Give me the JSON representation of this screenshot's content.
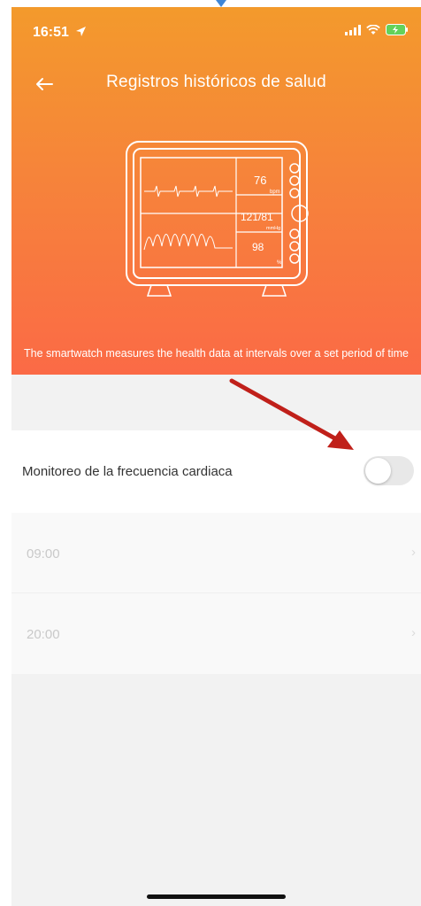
{
  "status": {
    "time": "16:51"
  },
  "nav": {
    "title": "Registros históricos de salud"
  },
  "monitor": {
    "heart_rate": "76",
    "heart_rate_unit": "bpm",
    "blood_pressure": "121/81",
    "bp_unit": "mmHg",
    "spo2": "98",
    "spo2_unit": "%"
  },
  "description": "The smartwatch measures the health data at intervals over a set period of time",
  "heart_rate_monitoring": {
    "label": "Monitoreo de la frecuencia cardiaca",
    "enabled": false
  },
  "schedule": {
    "start_time": "09:00",
    "end_time": "20:00"
  },
  "colors": {
    "gradient_top": "#f39a2c",
    "gradient_bottom": "#fb6a46",
    "annotation_arrow": "#c0201a"
  },
  "icons": [
    "location-arrow-icon",
    "signal-icon",
    "wifi-icon",
    "battery-charging-icon",
    "back-arrow-icon",
    "chevron-right-icon"
  ]
}
